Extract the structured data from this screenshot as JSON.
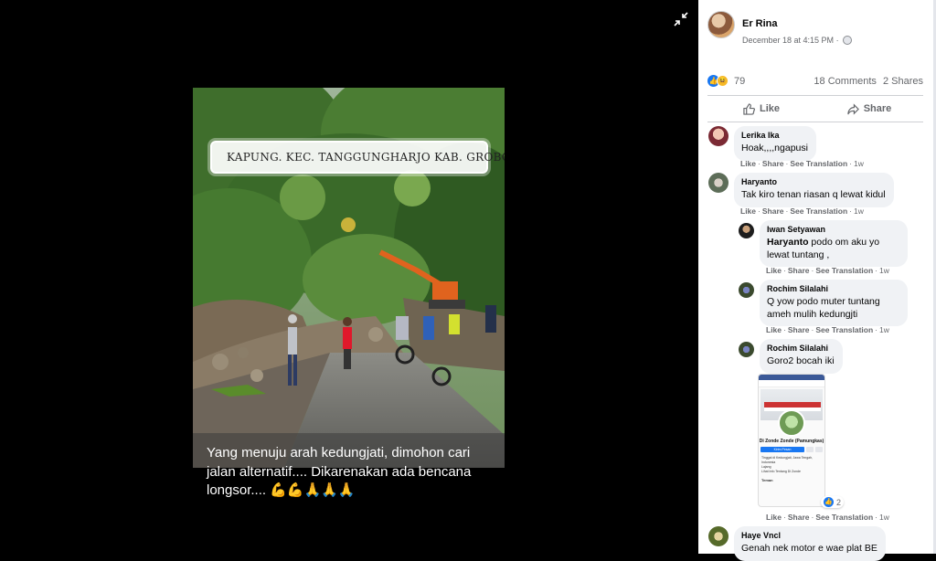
{
  "photo": {
    "location_banner": "KAPUNG. KEC. TANGGUNGHARJO KAB. GROBOG...",
    "caption": "Yang menuju arah kedungjati, dimohon cari jalan alternatif.... Dikarenakan ada bencana longsor.... 💪💪🙏🙏🙏"
  },
  "post": {
    "author": "Er Rina",
    "time": "December 18 at 4:15 PM",
    "dot": "·",
    "reaction_count": "79",
    "comments_count": "18 Comments",
    "shares_count": "2 Shares",
    "like_label": "Like",
    "share_label": "Share"
  },
  "comments": [
    {
      "name": "Lerika Ika",
      "text": "Hoak,,,,ngapusi",
      "like": "Like",
      "share": "Share",
      "translate": "See Translation",
      "time": "1w"
    },
    {
      "name": "Haryanto",
      "text": "Tak kiro tenan riasan q lewat kidul",
      "like": "Like",
      "share": "Share",
      "translate": "See Translation",
      "time": "1w"
    },
    {
      "name": "Iwan Setyawan",
      "mention": "Haryanto",
      "text": " podo om aku yo lewat tuntang ,",
      "like": "Like",
      "share": "Share",
      "translate": "See Translation",
      "time": "1w"
    },
    {
      "name": "Rochim Silalahi",
      "text": "Q yow podo muter tuntang ameh mulih kedungjti",
      "like": "Like",
      "share": "Share",
      "translate": "See Translation",
      "time": "1w"
    },
    {
      "name": "Rochim Silalahi",
      "text": "Goro2 bocah iki",
      "like": "Like",
      "share": "Share",
      "translate": "See Translation",
      "time": "1w",
      "attachment_reactions": "2"
    },
    {
      "name": "Haye Vncl",
      "text": "Genah nek motor e wae plat BE"
    }
  ],
  "attachment": {
    "page_name": "Di Zonde Zonde",
    "page_sub": "(Pamungkas)",
    "button": "Kirim Pesan",
    "line1": "Tinggal di Kedungjati, Jawa Tengah, Indonesia",
    "line2": "Lajang",
    "line3": "Lihat Info Tentang Di Zonde",
    "footer": "Teman"
  },
  "colors": {
    "accent": "#1877f2",
    "haha": "#f7b928",
    "bubble": "#f0f2f5"
  },
  "icons": [
    "collapse-icon",
    "location-pin-icon",
    "globe-icon",
    "like-reaction-icon",
    "haha-reaction-icon",
    "thumbs-up-icon",
    "share-arrow-icon"
  ]
}
